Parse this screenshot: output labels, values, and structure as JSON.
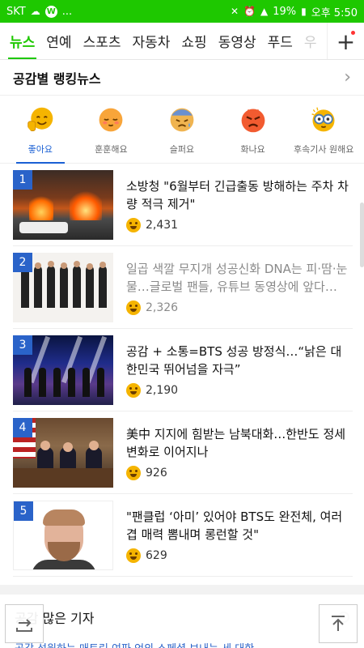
{
  "status_bar": {
    "carrier": "SKT",
    "more": "...",
    "battery": "19%",
    "time": "오후 5:50",
    "bg_color": "#1ec800"
  },
  "tabs": [
    {
      "label": "뉴스",
      "active": true
    },
    {
      "label": "연예"
    },
    {
      "label": "스포츠"
    },
    {
      "label": "자동차"
    },
    {
      "label": "쇼핑"
    },
    {
      "label": "동영상"
    },
    {
      "label": "푸드"
    },
    {
      "label": "우"
    }
  ],
  "add_tab_icon": "+",
  "section": {
    "title": "공감별 랭킹뉴스"
  },
  "emotions": [
    {
      "label": "좋아요",
      "icon": "like-face-icon",
      "color": "#f5b400",
      "active": true
    },
    {
      "label": "훈훈해요",
      "icon": "warm-face-icon",
      "color": "#f8a53a"
    },
    {
      "label": "슬퍼요",
      "icon": "sad-face-icon",
      "color": "#f0b450"
    },
    {
      "label": "화나요",
      "icon": "angry-face-icon",
      "color": "#f25b30"
    },
    {
      "label": "후속기사 원해요",
      "icon": "follow-up-face-icon",
      "color": "#f5b400"
    }
  ],
  "news": [
    {
      "rank": "1",
      "headline": "소방청 \"6월부터 긴급출동 방해하는 주차 차량 적극 제거\"",
      "count": "2,431",
      "visited": false
    },
    {
      "rank": "2",
      "headline": "일곱 색깔 무지개 성공신화 DNA는 피·땀·눈물…글로벌 팬들, 유튜브 동영상에 앞다…",
      "count": "2,326",
      "visited": true
    },
    {
      "rank": "3",
      "headline": "공감 + 소통=BTS 성공 방정식…“낡은 대한민국 뛰어넘을 자극”",
      "count": "2,190",
      "visited": false
    },
    {
      "rank": "4",
      "headline": "美中 지지에 힘받는 남북대화…한반도 정세 변화로 이어지나",
      "count": "926",
      "visited": false
    },
    {
      "rank": "5",
      "headline": "\"팬클럽 ‘아미’ 있어야 BTS도 완전체, 여러 겹 매력 뽐내며 롱런할 것\"",
      "count": "629",
      "visited": false
    }
  ],
  "next_section": {
    "title": "공감 많은 기자",
    "preview": "공감 성원하는 매트린 여파 언의 스페셜 보내는 세 대한…"
  },
  "accent_color": "#1ec800",
  "rank_color": "#2a63c9"
}
